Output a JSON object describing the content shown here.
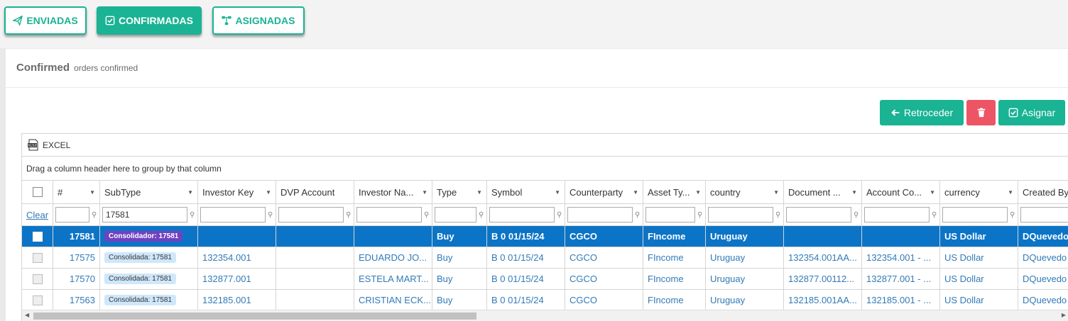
{
  "tabs": [
    {
      "label": "ENVIADAS",
      "icon": "paper-plane-icon",
      "active": false
    },
    {
      "label": "CONFIRMADAS",
      "icon": "check-square-icon",
      "active": true
    },
    {
      "label": "ASIGNADAS",
      "icon": "sitemap-icon",
      "active": false
    }
  ],
  "card": {
    "title": "Confirmed",
    "subtitle": "orders confirmed"
  },
  "actions": {
    "back_label": "Retroceder",
    "delete_icon": "trash-icon",
    "assign_label": "Asignar"
  },
  "grid": {
    "excel_label": "EXCEL",
    "group_hint": "Drag a column header here to group by that column",
    "clear_label": "Clear",
    "columns": [
      "#",
      "SubType",
      "Investor Key",
      "DVP Account",
      "Investor Na...",
      "Type",
      "Symbol",
      "Counterparty",
      "Asset Ty...",
      "country",
      "Document ...",
      "Account Co...",
      "currency",
      "Created By"
    ],
    "filters": {
      "subtype": "17581"
    },
    "rows": [
      {
        "id": "17581",
        "subtype": "Consolidador: 17581",
        "investor_key": "",
        "dvp": "",
        "investor_name": "",
        "type": "Buy",
        "symbol": "B 0 01/15/24",
        "counterparty": "CGCO",
        "asset_type": "FIncome",
        "country": "Uruguay",
        "document": "",
        "account": "",
        "currency": "US Dollar",
        "created_by": "DQuevedo"
      },
      {
        "id": "17575",
        "subtype": "Consolidada: 17581",
        "investor_key": "132354.001",
        "dvp": "",
        "investor_name": "EDUARDO JO...",
        "type": "Buy",
        "symbol": "B 0 01/15/24",
        "counterparty": "CGCO",
        "asset_type": "FIncome",
        "country": "Uruguay",
        "document": "132354.001AA...",
        "account": "132354.001 - ...",
        "currency": "US Dollar",
        "created_by": "DQuevedo"
      },
      {
        "id": "17570",
        "subtype": "Consolidada: 17581",
        "investor_key": "132877.001",
        "dvp": "",
        "investor_name": "ESTELA MART...",
        "type": "Buy",
        "symbol": "B 0 01/15/24",
        "counterparty": "CGCO",
        "asset_type": "FIncome",
        "country": "Uruguay",
        "document": "132877.00112...",
        "account": "132877.001 - ...",
        "currency": "US Dollar",
        "created_by": "DQuevedo"
      },
      {
        "id": "17563",
        "subtype": "Consolidada: 17581",
        "investor_key": "132185.001",
        "dvp": "",
        "investor_name": "CRISTIAN ECK...",
        "type": "Buy",
        "symbol": "B 0 01/15/24",
        "counterparty": "CGCO",
        "asset_type": "FIncome",
        "country": "Uruguay",
        "document": "132185.001AA...",
        "account": "132185.001 - ...",
        "currency": "US Dollar",
        "created_by": "DQuevedo"
      }
    ]
  }
}
